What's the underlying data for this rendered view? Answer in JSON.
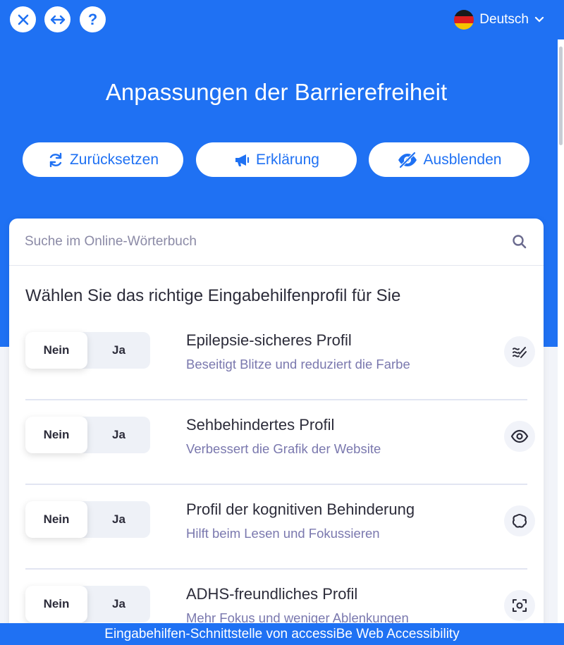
{
  "language": {
    "label": "Deutsch",
    "flag_icon": "german-flag-icon"
  },
  "header": {
    "title": "Anpassungen der Barrierefreiheit"
  },
  "actions": [
    {
      "label": "Zurücksetzen",
      "icon": "reset-icon"
    },
    {
      "label": "Erklärung",
      "icon": "megaphone-icon"
    },
    {
      "label": "Ausblenden",
      "icon": "hide-eye-icon"
    }
  ],
  "search": {
    "placeholder": "Suche im Online-Wörterbuch"
  },
  "profiles_section": {
    "title": "Wählen Sie das richtige Eingabehilfenprofil für Sie"
  },
  "toggle": {
    "no": "Nein",
    "yes": "Ja"
  },
  "profiles": [
    {
      "name": "Epilepsie-sicheres Profil",
      "desc": "Beseitigt Blitze und reduziert die Farbe",
      "icon": "wave-icon"
    },
    {
      "name": "Sehbehindertes Profil",
      "desc": "Verbessert die Grafik der Website",
      "icon": "eye-icon"
    },
    {
      "name": "Profil der kognitiven Behinderung",
      "desc": "Hilft beim Lesen und Fokussieren",
      "icon": "brain-icon"
    },
    {
      "name": "ADHS-freundliches Profil",
      "desc": "Mehr Fokus und weniger Ablenkungen",
      "icon": "focus-icon"
    }
  ],
  "footer": {
    "text": "Eingabehilfen-Schnittstelle von accessiBe Web Accessibility"
  },
  "colors": {
    "brand": "#1f71f3",
    "accent_text": "#7a78ae"
  }
}
